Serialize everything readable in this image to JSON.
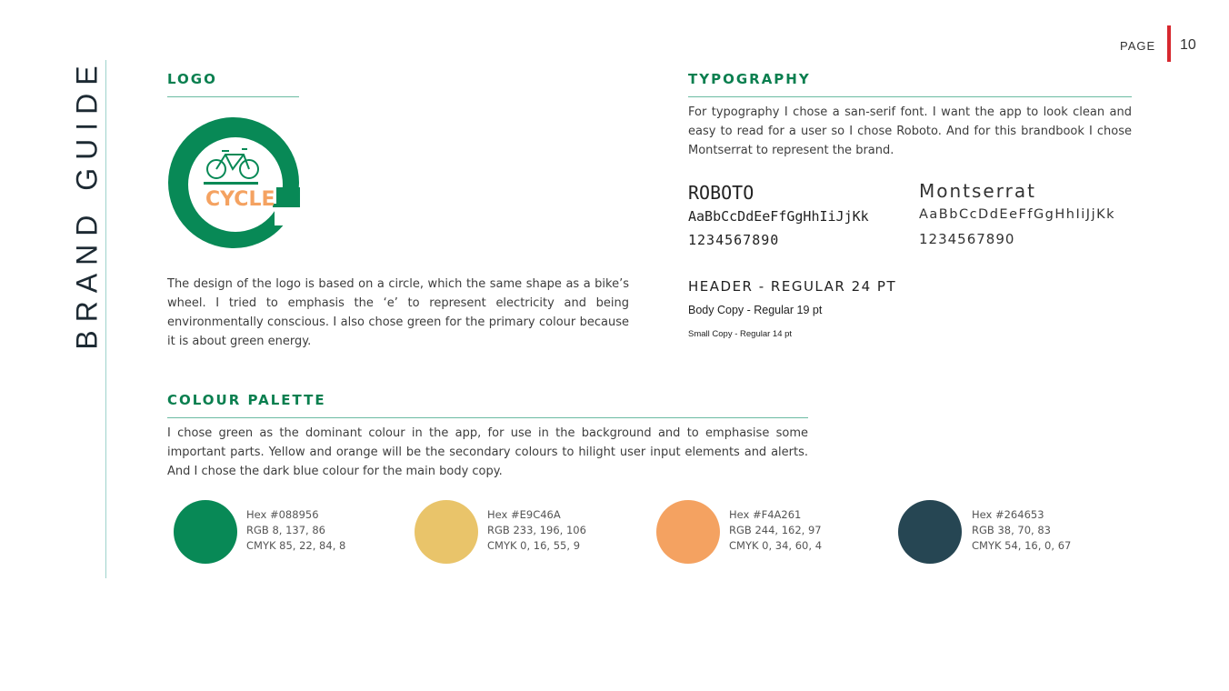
{
  "side_title": "BRAND GUIDE",
  "page": {
    "label": "PAGE",
    "number": "10"
  },
  "logo_section": {
    "heading": "LOGO",
    "logo_text": "CYCLE",
    "description": "The design of the logo is based on a circle, which the same shape as a bike’s wheel. I tried to emphasis the ‘e’ to represent electricity and being environmentally conscious. I also chose green for the primary colour because it is about green energy."
  },
  "typography": {
    "heading": "TYPOGRAPHY",
    "description": "For typography I chose a san-serif font. I want the app to look clean and easy to read for a user so I chose Roboto. And for this brandbook I chose Montserrat to represent the brand.",
    "fonts": [
      {
        "name": "ROBOTO",
        "alphabet": "AaBbCcDdEeFfGgHhIiJjKk",
        "digits": "1234567890"
      },
      {
        "name": "Montserrat",
        "alphabet": "AaBbCcDdEeFfGgHhIiJjKk",
        "digits": "1234567890"
      }
    ],
    "samples": {
      "header": "HEADER - REGULAR 24 PT",
      "body": "Body Copy - Regular 19 pt",
      "small": "Small Copy - Regular 14 pt"
    }
  },
  "palette": {
    "heading": "COLOUR PALETTE",
    "description": "I chose green as the dominant colour in the app, for use in the background and to emphasise some important parts. Yellow and orange will be the secondary colours to hilight user input elements and alerts. And I chose the dark blue colour for the main body copy.",
    "colors": [
      {
        "color": "#088956",
        "hex": "Hex #088956",
        "rgb": "RGB 8, 137, 86",
        "cmyk": "CMYK 85, 22, 84, 8"
      },
      {
        "color": "#E9C46A",
        "hex": "Hex #E9C46A",
        "rgb": "RGB 233, 196, 106",
        "cmyk": "CMYK 0, 16, 55, 9"
      },
      {
        "color": "#F4A261",
        "hex": "Hex #F4A261",
        "rgb": "RGB 244, 162, 97",
        "cmyk": "CMYK 0, 34, 60, 4"
      },
      {
        "color": "#264653",
        "hex": "Hex  #264653",
        "rgb": "RGB 38, 70, 83",
        "cmyk": "CMYK 54, 16, 0, 67"
      }
    ]
  }
}
